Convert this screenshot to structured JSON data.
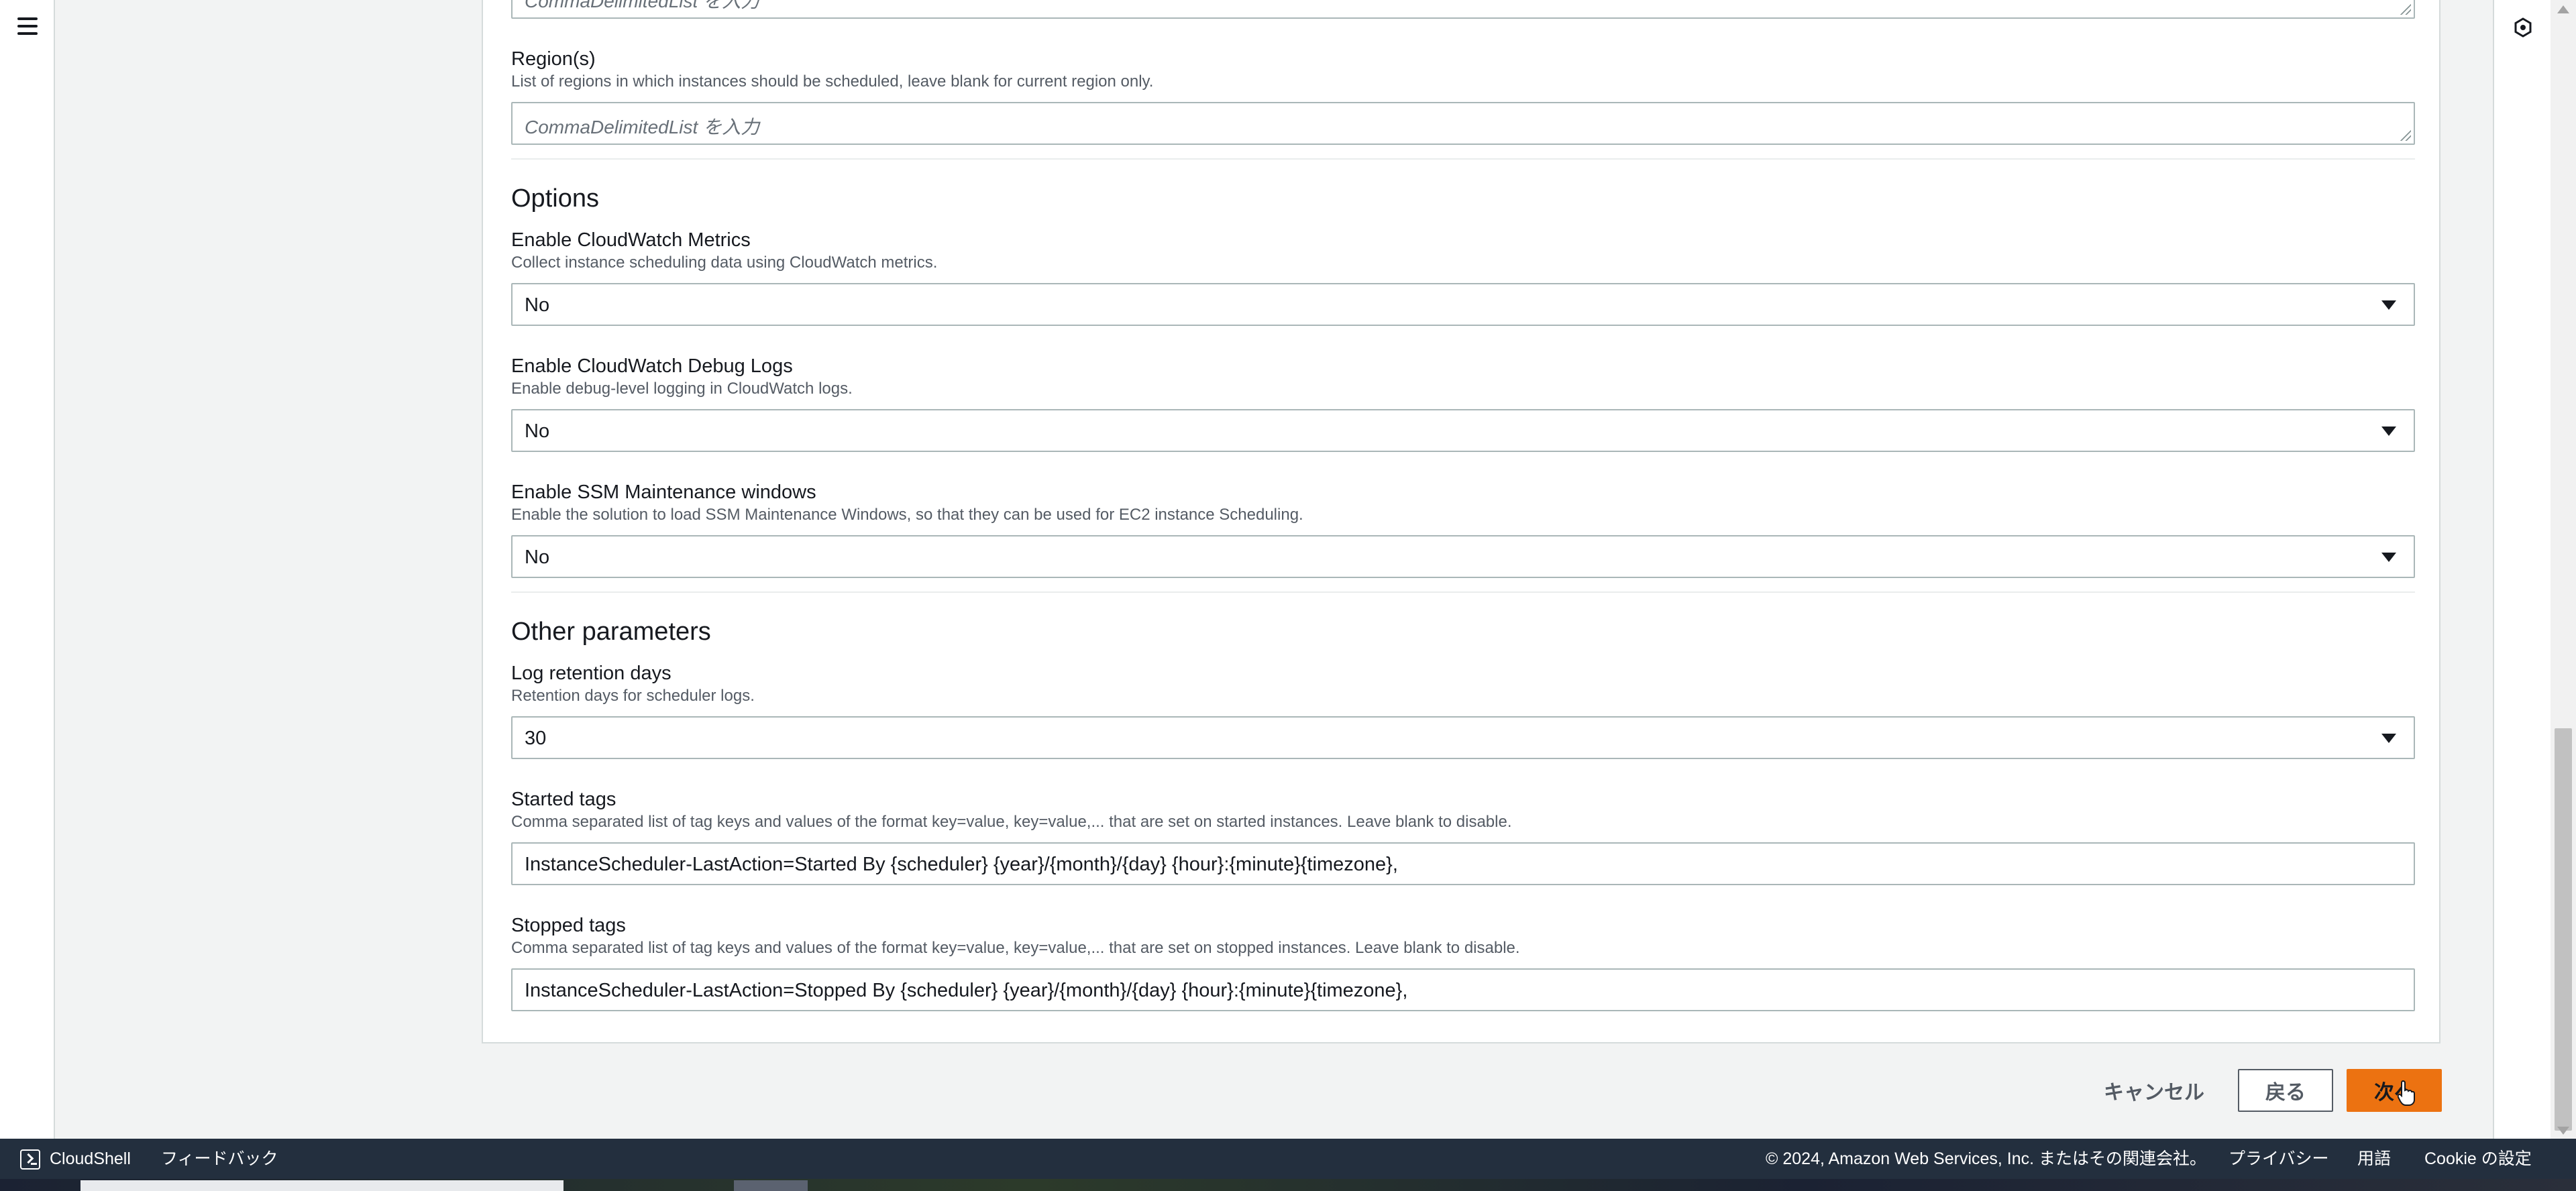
{
  "regions": {
    "partial_placeholder": "CommaDelimitedList を入力",
    "label": "Region(s)",
    "description": "List of regions in which instances should be scheduled, leave blank for current region only.",
    "placeholder": "CommaDelimitedList を入力"
  },
  "options": {
    "title": "Options",
    "cloudwatch_metrics": {
      "label": "Enable CloudWatch Metrics",
      "description": "Collect instance scheduling data using CloudWatch metrics.",
      "value": "No"
    },
    "debug_logs": {
      "label": "Enable CloudWatch Debug Logs",
      "description": "Enable debug-level logging in CloudWatch logs.",
      "value": "No"
    },
    "ssm_windows": {
      "label": "Enable SSM Maintenance windows",
      "description": "Enable the solution to load SSM Maintenance Windows, so that they can be used for EC2 instance Scheduling.",
      "value": "No"
    }
  },
  "other": {
    "title": "Other parameters",
    "log_retention": {
      "label": "Log retention days",
      "description": "Retention days for scheduler logs.",
      "value": "30"
    },
    "started_tags": {
      "label": "Started tags",
      "description": "Comma separated list of tag keys and values of the format key=value, key=value,... that are set on started instances. Leave blank to disable.",
      "value": "InstanceScheduler-LastAction=Started By {scheduler} {year}/{month}/{day} {hour}:{minute}{timezone},"
    },
    "stopped_tags": {
      "label": "Stopped tags",
      "description": "Comma separated list of tag keys and values of the format key=value, key=value,... that are set on stopped instances. Leave blank to disable.",
      "value": "InstanceScheduler-LastAction=Stopped By {scheduler} {year}/{month}/{day} {hour}:{minute}{timezone},"
    }
  },
  "actions": {
    "cancel": "キャンセル",
    "back": "戻る",
    "next": "次へ"
  },
  "footer": {
    "cloudshell": "CloudShell",
    "feedback": "フィードバック",
    "copyright": "© 2024, Amazon Web Services, Inc. またはその関連会社。",
    "privacy": "プライバシー",
    "terms": "用語",
    "cookie": "Cookie の設定"
  },
  "colors": {
    "primary_button": "#ec7211",
    "footer_bg": "#232f3e"
  }
}
